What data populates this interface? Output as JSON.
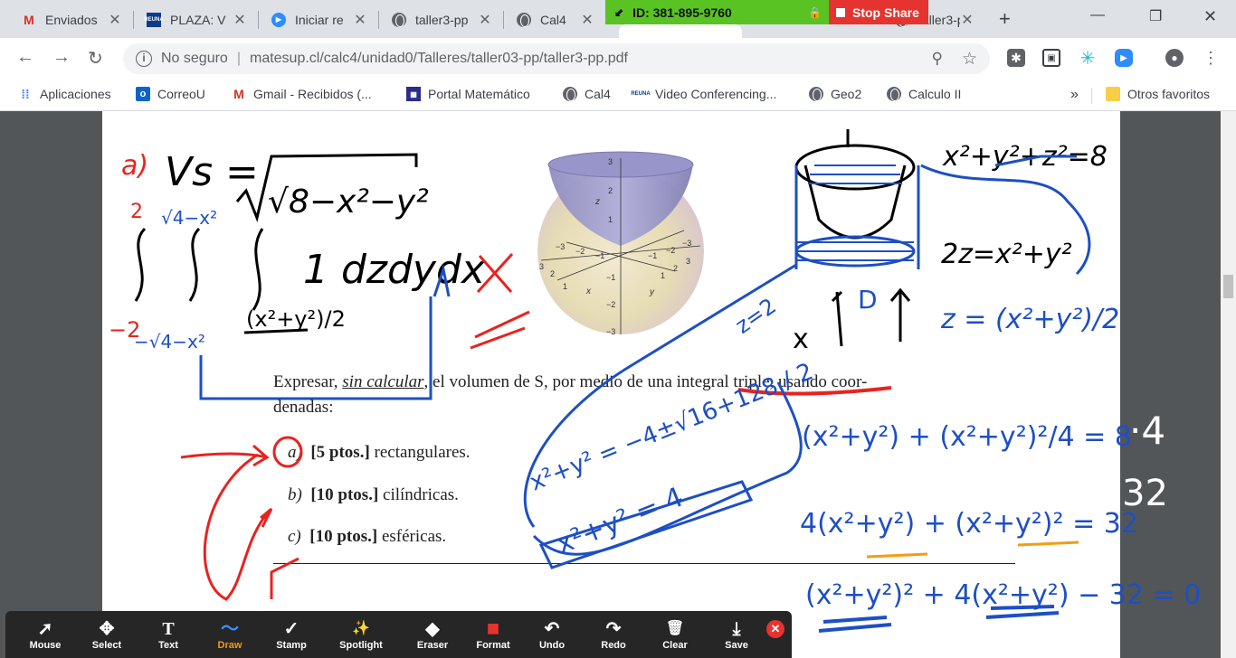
{
  "tabs": [
    {
      "title": "Enviados",
      "favicon": "gmail-icon",
      "active": false
    },
    {
      "title": "PLAZA: V",
      "favicon": "reuna-icon",
      "active": false
    },
    {
      "title": "Iniciar re",
      "favicon": "zoom-icon",
      "active": false
    },
    {
      "title": "taller3-pp",
      "favicon": "globe-icon",
      "active": false
    },
    {
      "title": "Cal4",
      "favicon": "globe-icon",
      "active": false
    },
    {
      "title": "taller3-pp",
      "favicon": "globe-icon",
      "active": true
    }
  ],
  "zoom_share": {
    "meeting_id": "ID: 381-895-9760",
    "stop_label": "Stop Share",
    "colors": {
      "id_bg": "#58c322",
      "stop_bg": "#e5342f"
    }
  },
  "toolbar": {
    "security_label": "No seguro",
    "url": "matesup.cl/calc4/unidad0/Talleres/taller03-pp/taller3-pp.pdf",
    "extensions": [
      "puzzle-icon",
      "screenshot-icon",
      "perplexity-icon",
      "zoom-icon"
    ]
  },
  "bookmarks": [
    {
      "label": "Aplicaciones",
      "icon": "apps-grid-icon"
    },
    {
      "label": "CorreoU",
      "icon": "outlook-icon"
    },
    {
      "label": "Gmail - Recibidos (...",
      "icon": "gmail-icon"
    },
    {
      "label": "Portal Matemático",
      "icon": "portal-icon"
    },
    {
      "label": "Cal4",
      "icon": "globe-icon"
    },
    {
      "label": "Video Conferencing...",
      "icon": "reuna-icon"
    },
    {
      "label": "Geo2",
      "icon": "globe-icon"
    },
    {
      "label": "Calculo II",
      "icon": "globe-icon"
    }
  ],
  "bookmarks_more": "»",
  "bookmarks_other": "Otros favoritos",
  "pdf": {
    "paragraph_line1_a": "Expresar, ",
    "paragraph_line1_em": "sin calcular",
    "paragraph_line1_b": ", el volumen de S, por medio de una integral triple, usando coor-",
    "paragraph_line2": "denadas:",
    "items": [
      {
        "letter": "a)",
        "points": "[5 ptos.]",
        "text": "rectangulares."
      },
      {
        "letter": "b)",
        "points": "[10 ptos.]",
        "text": "cilíndricas."
      },
      {
        "letter": "c)",
        "points": "[10 ptos.]",
        "text": "esféricas."
      }
    ],
    "figure": {
      "z_ticks": [
        "3",
        "2",
        "1",
        "−1",
        "−2",
        "−3"
      ],
      "axis_labels": {
        "x": "x",
        "y": "y",
        "z": "z"
      },
      "side_ticks_left": [
        "−3",
        "−2",
        "−1",
        "1",
        "2",
        "3"
      ],
      "side_ticks_right": [
        "−3",
        "−2",
        "−1",
        "1",
        "2",
        "3"
      ]
    }
  },
  "handwriting": {
    "left_label": "a)",
    "vs": "Vs =",
    "root": "√8−x²−y²",
    "integrand": "1 dzdydx",
    "upper_outer": "2",
    "lower_outer": "−2",
    "upper_mid": "√4−x²",
    "lower_mid": "−√4−x²",
    "lower_inner": "(x²+y²)/2",
    "eq_sphere": "x²+y²+z²=8",
    "eq_para": "2z=x²+y²",
    "eq_z": "z = (x²+y²)/2",
    "z2": "z=2",
    "quad": "x²+y² = −4±√16+128 / 2",
    "circle": "x²+y² = 4",
    "exp1": "(x²+y²) + (x²+y²)²/4 = 8",
    "exp2": "4(x²+y²) + (x²+y²)² = 32",
    "exp3": "(x²+y²)² + 4(x²+y²) − 32 = 0",
    "side": "·4",
    "side2": "32",
    "x_label": "x",
    "d_label": "D"
  },
  "annotate_tools": [
    {
      "label": "Mouse",
      "icon": "cursor-icon",
      "glyph": "➚",
      "active": false
    },
    {
      "label": "Select",
      "icon": "move-icon",
      "glyph": "✥",
      "active": false
    },
    {
      "label": "Text",
      "icon": "text-icon",
      "glyph": "T",
      "active": false
    },
    {
      "label": "Draw",
      "icon": "draw-icon",
      "glyph": "〜",
      "active": true
    },
    {
      "label": "Stamp",
      "icon": "check-icon",
      "glyph": "✓",
      "active": false
    },
    {
      "label": "Spotlight",
      "icon": "spotlight-icon",
      "glyph": "✨",
      "active": false
    },
    {
      "label": "Eraser",
      "icon": "eraser-icon",
      "glyph": "◆",
      "active": false
    },
    {
      "label": "Format",
      "icon": "format-icon",
      "glyph": "■",
      "active": false
    },
    {
      "label": "Undo",
      "icon": "undo-icon",
      "glyph": "↶",
      "active": false
    },
    {
      "label": "Redo",
      "icon": "redo-icon",
      "glyph": "↷",
      "active": false
    },
    {
      "label": "Clear",
      "icon": "trash-icon",
      "glyph": "🗑",
      "active": false
    },
    {
      "label": "Save",
      "icon": "save-icon",
      "glyph": "⤓",
      "active": false
    }
  ]
}
